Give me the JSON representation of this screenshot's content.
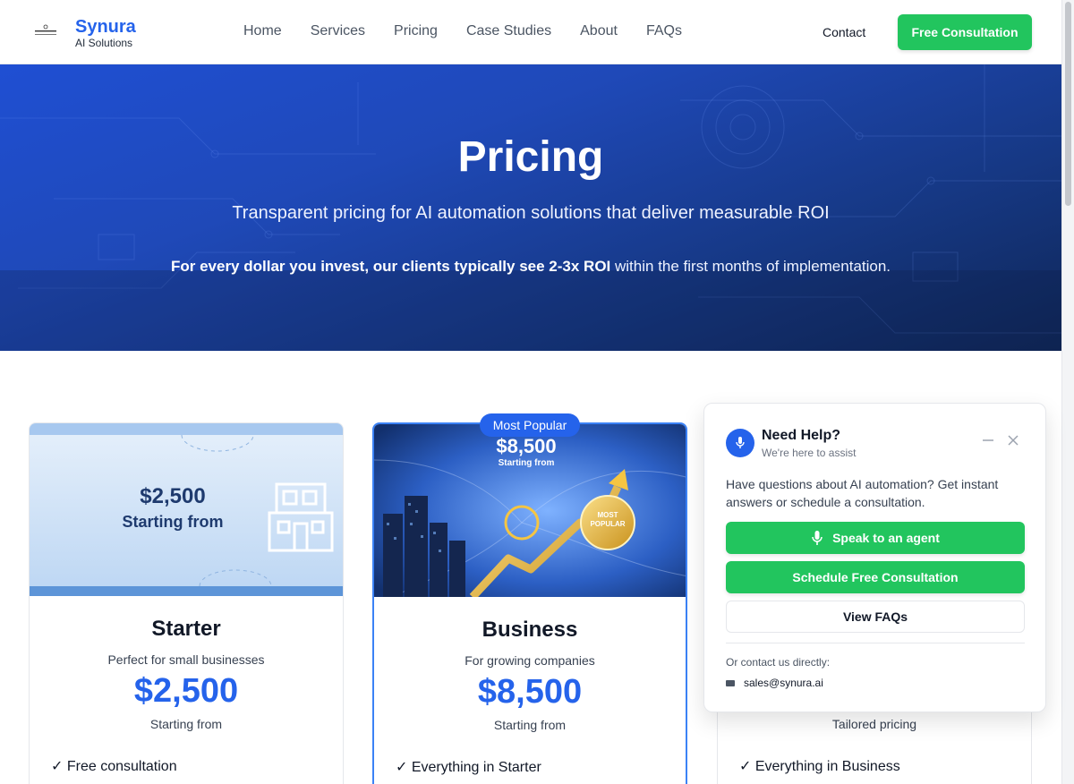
{
  "brand": {
    "name": "Synura",
    "tagline": "AI Solutions"
  },
  "nav": {
    "items": [
      "Home",
      "Services",
      "Pricing",
      "Case Studies",
      "About",
      "FAQs"
    ]
  },
  "header": {
    "contact": "Contact",
    "cta": "Free Consultation"
  },
  "hero": {
    "title": "Pricing",
    "subtitle": "Transparent pricing for AI automation solutions that deliver measurable ROI",
    "roi_bold": "For every dollar you invest, our clients typically see 2-3x ROI",
    "roi_rest": " within the first months of implementation."
  },
  "plans": [
    {
      "image_price": "$2,500",
      "image_caption": "Starting from",
      "name": "Starter",
      "description": "Perfect for small businesses",
      "price": "$2,500",
      "price_note": "Starting from",
      "first_feature": "✓ Free consultation"
    },
    {
      "badge": "Most Popular",
      "image_price": "$8,500",
      "image_caption": "Starting from",
      "image_badge": [
        "MOST",
        "POPULAR"
      ],
      "name": "Business",
      "description": "For growing companies",
      "price": "$8,500",
      "price_note": "Starting from",
      "first_feature": "✓ Everything in Starter"
    },
    {
      "price_note": "Tailored pricing",
      "first_feature": "✓ Everything in Business"
    }
  ],
  "help_widget": {
    "title": "Need Help?",
    "subtitle": "We're here to assist",
    "body": "Have questions about AI automation? Get instant answers or schedule a consultation.",
    "speak_button": "Speak to an agent",
    "schedule_button": "Schedule Free Consultation",
    "faqs_button": "View FAQs",
    "contact_label": "Or contact us directly:",
    "email": "sales@synura.ai"
  },
  "colors": {
    "primary": "#2563eb",
    "accent_green": "#22c55e",
    "hero_dark": "#0f2656"
  }
}
